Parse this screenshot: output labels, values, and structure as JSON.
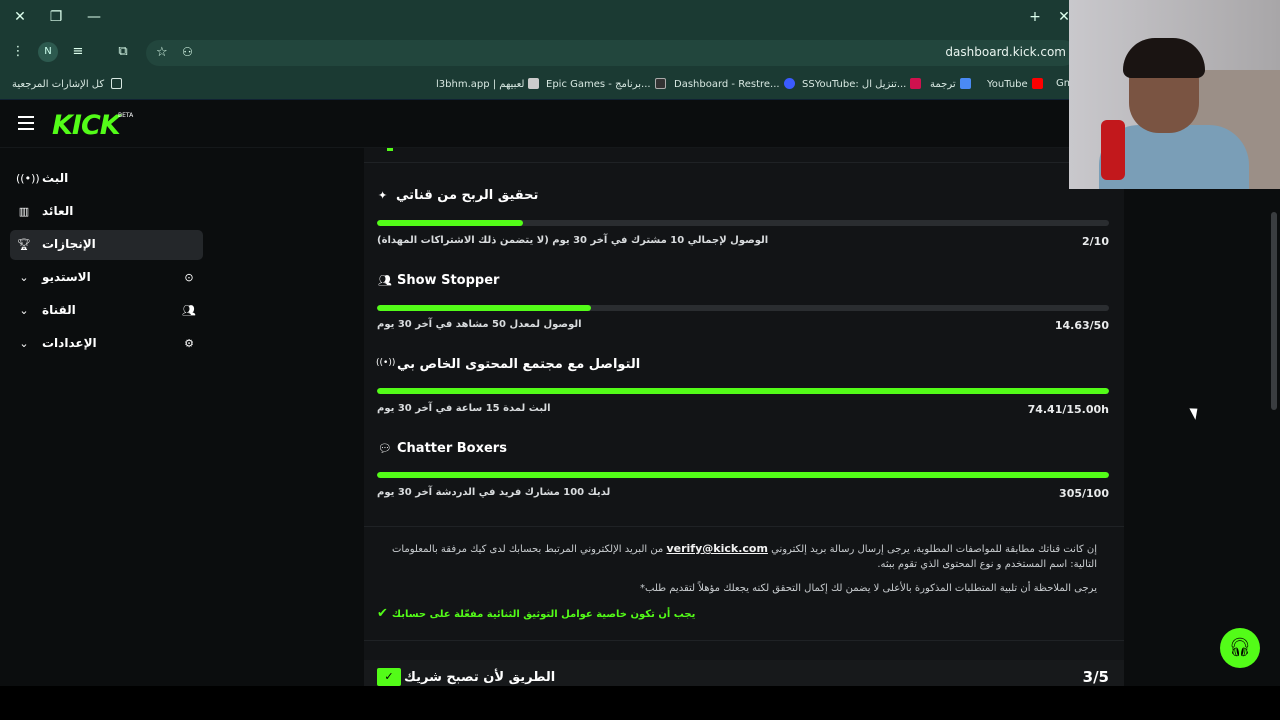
{
  "browser": {
    "url": "dashboard.kick.com",
    "profile_initial": "N",
    "bookmarks_all": "كل الإشارات المرجعية",
    "bookmarks": [
      "l3bhm.app | لعبيهم",
      "Epic Games - برنامج...",
      "Dashboard - Restre...",
      "SSYouTube: تنزيل ال...",
      "ترجمة",
      "YouTube",
      "Gm"
    ]
  },
  "app": {
    "logo": "KICK",
    "beta": "BETA"
  },
  "sidebar": {
    "items": [
      {
        "label": "البث",
        "icon": "broadcast-icon"
      },
      {
        "label": "العائد",
        "icon": "chart-icon"
      },
      {
        "label": "الإنجازات",
        "icon": "trophy-icon"
      },
      {
        "label": "الاستديو",
        "icon": "chevron-down-icon"
      },
      {
        "label": "القناة",
        "icon": "chevron-down-icon"
      },
      {
        "label": "الإعدادات",
        "icon": "chevron-down-icon"
      }
    ]
  },
  "achievements": [
    {
      "title": "تحقيق الربح من قناتي",
      "note": "الوصول لإجمالي 10 مشترك في آخر 30 يوم (لا يتضمن ذلك الاشتراكات المهداة)",
      "value": "2/10",
      "progress": 0.2
    },
    {
      "title": "Show Stopper",
      "note": "الوصول لمعدل 50 مشاهد في آخر 30 يوم",
      "value": "14.63/50",
      "progress": 0.293
    },
    {
      "title": "التواصل مع مجتمع المحتوى الخاص بي",
      "note": "البث لمدة 15 ساعة في آخر 30 يوم",
      "value": "74.41/15.00h",
      "progress": 1.0
    },
    {
      "title": "Chatter Boxers",
      "note": "لديك 100 مشارك فريد في الدردشة آخر 30 يوم",
      "value": "305/100",
      "progress": 1.0
    }
  ],
  "info": {
    "line1_prefix": "إن كانت قناتك مطابقة للمواصفات المطلوبة، يرجى إرسال رسالة بريد إلكتروني",
    "email": "verify@kick.com",
    "line1_suffix": "من البريد الإلكتروني المرتبط بحسابك لدى كيك مرفقة بالمعلومات التالية: اسم المستخدم و نوع المحتوى الذي تقوم ببثه.",
    "note": "يرجى الملاحظة أن تلبية المتطلبات المذكورة بالأعلى لا يضمن لك إكمال التحقق لكنه يجعلك مؤهلاً لتقديم طلب*",
    "two_factor": "يجب أن تكون خاصية عوامل التوثيق الثنائية مفعّلة على حسابك"
  },
  "next_section": {
    "title": "الطريق لأن تصبح شريك",
    "count": "3/5"
  },
  "colors": {
    "accent": "#53fc18"
  }
}
